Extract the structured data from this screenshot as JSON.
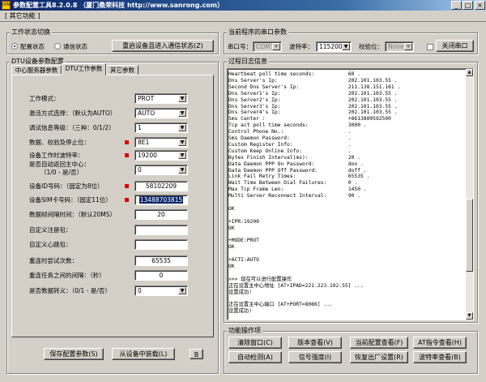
{
  "titlebar": {
    "app_icon_text": "ION",
    "title": "参数配置工具8.2.0.8 （厦门桑荣科技 http://www.sanrong.com）",
    "min": "_",
    "max": "□",
    "close": "×"
  },
  "menu": {
    "item": "[ 其它功能 ]"
  },
  "status_group": {
    "label": "工作状态切换",
    "config_state": "配置状态",
    "comm_state": "通信状态",
    "restart_button": "重启设备且进入通信状态(Z)"
  },
  "serial_group": {
    "label": "当前程序的串口参数",
    "port_label": "串口号：",
    "port_value": "COM1",
    "baud_label": "波特率：",
    "baud_value": "115200",
    "parity_label": "校验位：",
    "parity_value": "None",
    "close_button": "关闭串口"
  },
  "dtu_group": {
    "label": "DTU设备参数配置",
    "tabs": [
      "中心服务器参数",
      "DTU工作参数",
      "其它参数"
    ],
    "rows": [
      {
        "label": "工作模式：",
        "value": "PROT",
        "type": "combo",
        "required": false
      },
      {
        "label": "激活方式选择：（默认为AUTO）",
        "value": "AUTO",
        "type": "combo",
        "required": false
      },
      {
        "label": "调试信息等级：（三种：0/1/2）",
        "value": "1",
        "type": "combo",
        "required": false
      },
      {
        "label": "数据、校验及停止位：",
        "value": "8E1",
        "type": "combo",
        "required": true
      },
      {
        "label": "设备工作时波特率：",
        "value": "19200",
        "type": "combo",
        "required": true
      },
      {
        "label": "是否自动返回主中心：",
        "label2": "（1/0 - 是/否）",
        "value": "0",
        "type": "combo",
        "required": false
      },
      {
        "label": "设备ID号码：（固定为8位）",
        "value": "58102209",
        "type": "field",
        "required": true
      },
      {
        "label": "设备SIM卡号码：（固定11位）",
        "value": "13488703815",
        "type": "field",
        "required": true,
        "selected": true
      },
      {
        "label": "数据帧间隔时间：（默认20MS）",
        "value": "20",
        "type": "field",
        "required": false
      },
      {
        "label": "自定义注册包：",
        "value": "",
        "type": "field",
        "required": false
      },
      {
        "label": "自定义心跳包：",
        "value": "",
        "type": "field",
        "required": false
      },
      {
        "label": "重连时尝试次数：",
        "value": "65535",
        "type": "field",
        "required": false
      },
      {
        "label": "重连任务之间的间隔：（秒）",
        "value": "0",
        "type": "field",
        "required": false
      },
      {
        "label": "是否数据转义：（0/1 - 是/否）",
        "value": "0",
        "type": "combo",
        "required": false
      }
    ],
    "save_button": "保存配置参数(S)",
    "load_button": "从设备中装载(L)",
    "b_button": "B"
  },
  "log_group": {
    "label": "过程日志信息",
    "lines": [
      "Heartbeat poll time seconds:           60 .",
      "Dns Server's Ip:                       202.101.103.55 .",
      "Second Dns Server's Ip:                211.138.151.161 .",
      "Dns Server1's Ip:                      202.101.103.55 .",
      "Dns Server2's Ip:                      202.101.103.55 .",
      "Dns Server3's Ip:                      202.101.103.55 .",
      "Dns Server4's Ip:                      202.101.103.55 .",
      "Sms Center :                           +8613800592500",
      "Tcp act poll time seconds:             3000 .",
      "Control Phone No.:                     .",
      "Sms Daemon Password:                   .",
      "Custom Register Info:                  .",
      "Custom Keep Online Info:               .",
      "Bytes Finish Interval(ms):             20 .",
      "Data Daemon PPP On Password:           don .",
      "Data Daemon PPP Off Password:          doff .",
      "Link Fail Retry Times:                 65535 .",
      "Wait Time Between Dial Failures:       0 .",
      "Max Tcp Frame Len:                     1450 .",
      "Multi Server Reconnect Interval:       90 .",
      "",
      "OK",
      "",
      "+IPR:19200",
      "OK",
      "",
      "+MODE:PROT",
      "OK",
      "",
      "+ACTI:AUTO",
      "OK",
      "",
      ">>> 现在可以进行配置操作",
      "正在设置主中心地址 [AT+IPAD=221.223.102.55] ...",
      "设置成功!",
      "",
      "正在设置主中心端口 [AT+PORT=8086] ...",
      "设置成功!"
    ]
  },
  "ops_group": {
    "label": "功能操作项",
    "buttons": [
      [
        "清除窗口(C)",
        "版本查看(V)",
        "当前配置查看(F)",
        "AT指令查看(H)"
      ],
      [
        "自动检测(A)",
        "信号强度(I)",
        "恢复出厂设置(R)",
        "波特率查看(B)"
      ]
    ]
  }
}
